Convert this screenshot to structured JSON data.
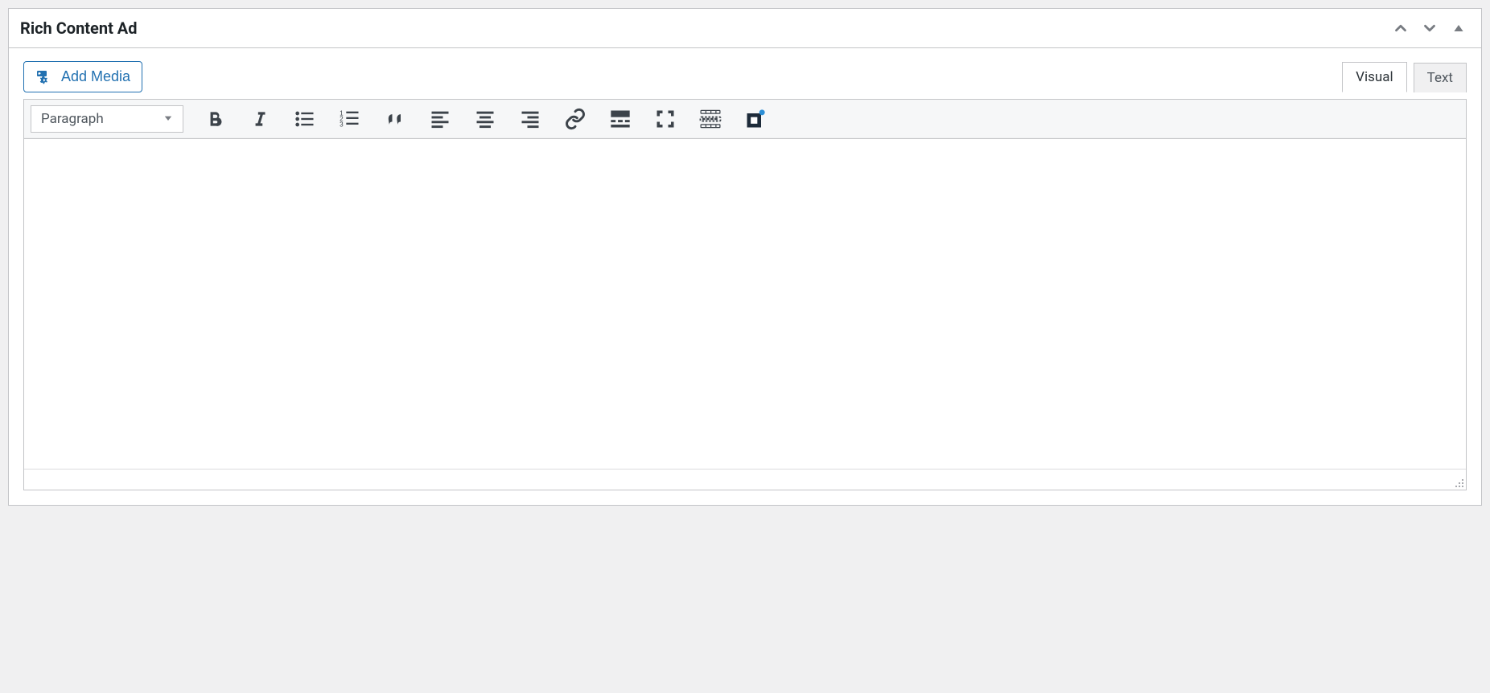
{
  "panel": {
    "title": "Rich Content Ad"
  },
  "media": {
    "add_media_label": "Add Media"
  },
  "tabs": {
    "visual": "Visual",
    "text": "Text",
    "active": "visual"
  },
  "toolbar": {
    "format_dropdown": "Paragraph",
    "buttons": [
      {
        "name": "bold",
        "label": "Bold"
      },
      {
        "name": "italic",
        "label": "Italic"
      },
      {
        "name": "bullet-list",
        "label": "Bulleted list"
      },
      {
        "name": "number-list",
        "label": "Numbered list"
      },
      {
        "name": "blockquote",
        "label": "Blockquote"
      },
      {
        "name": "align-left",
        "label": "Align left"
      },
      {
        "name": "align-center",
        "label": "Align center"
      },
      {
        "name": "align-right",
        "label": "Align right"
      },
      {
        "name": "link",
        "label": "Insert/edit link"
      },
      {
        "name": "read-more",
        "label": "Insert Read More tag"
      },
      {
        "name": "fullscreen",
        "label": "Fullscreen"
      },
      {
        "name": "toolbar-toggle",
        "label": "Toolbar Toggle"
      },
      {
        "name": "custom-badge",
        "label": "Plugin button"
      }
    ]
  },
  "editor": {
    "content": ""
  }
}
